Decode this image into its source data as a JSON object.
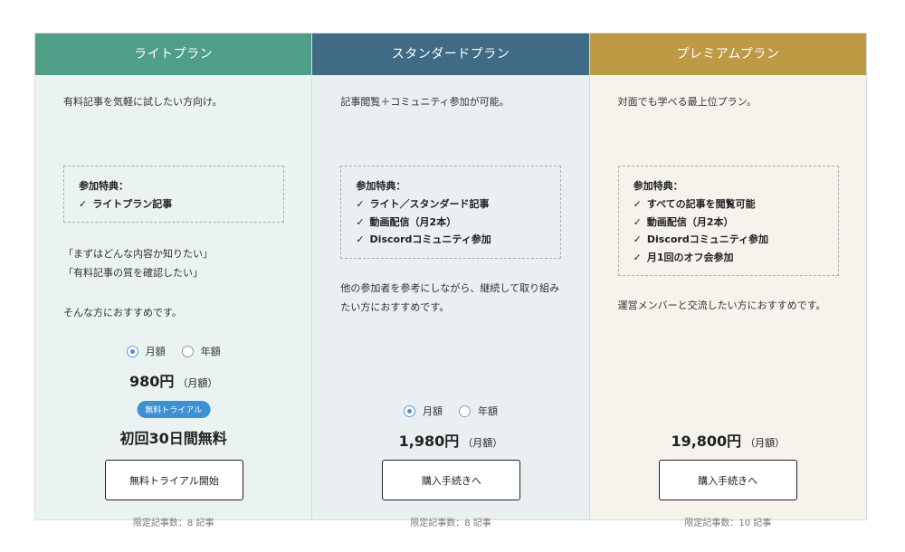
{
  "colors": {
    "light_header": "#4f9e88",
    "light_bg": "#eaf3f1",
    "standard_header": "#3f6b86",
    "standard_bg": "#eaeff2",
    "premium_header": "#bf9a45",
    "premium_bg": "#f5f3ec",
    "radio_selected": "#4a90d9",
    "trial_badge": "#3d8fd6"
  },
  "plans": [
    {
      "name": "ライトプラン",
      "description": "有料記事を気軽に試したい方向け。",
      "perks_title": "参加特典：",
      "perks": [
        "ライトプラン記事"
      ],
      "check_mark": "✓",
      "notes": [
        "「まずはどんな内容か知りたい」",
        "「有料記事の質を確認したい」",
        "",
        "そんな方におすすめです。"
      ],
      "billing_options": [
        "月額",
        "年額"
      ],
      "selected_billing": "月額",
      "price": "980円",
      "price_unit": "（月額）",
      "trial_badge": "無料トライアル",
      "trial_text": "初回30日間無料",
      "cta": "無料トライアル開始",
      "limit": "限定記事数：8 記事"
    },
    {
      "name": "スタンダードプラン",
      "description": "記事閲覧＋コミュニティ参加が可能。",
      "perks_title": "参加特典：",
      "perks": [
        "ライト／スタンダード記事",
        "動画配信（月2本）",
        "Discordコミュニティ参加"
      ],
      "check_mark": "✓",
      "notes": [
        "他の参加者を参考にしながら、継続して取り組み",
        "たい方におすすめです。"
      ],
      "billing_options": [
        "月額",
        "年額"
      ],
      "selected_billing": "月額",
      "price": "1,980円",
      "price_unit": "（月額）",
      "cta": "購入手続きへ",
      "limit": "限定記事数：8 記事"
    },
    {
      "name": "プレミアムプラン",
      "description": "対面でも学べる最上位プラン。",
      "perks_title": "参加特典：",
      "perks": [
        "すべての記事を閲覧可能",
        "動画配信（月2本）",
        "Discordコミュニティ参加",
        "月1回のオフ会参加"
      ],
      "check_mark": "✓",
      "notes": [
        "運営メンバーと交流したい方におすすめです。"
      ],
      "price": "19,800円",
      "price_unit": "（月額）",
      "cta": "購入手続きへ",
      "limit": "限定記事数：10 記事"
    }
  ]
}
